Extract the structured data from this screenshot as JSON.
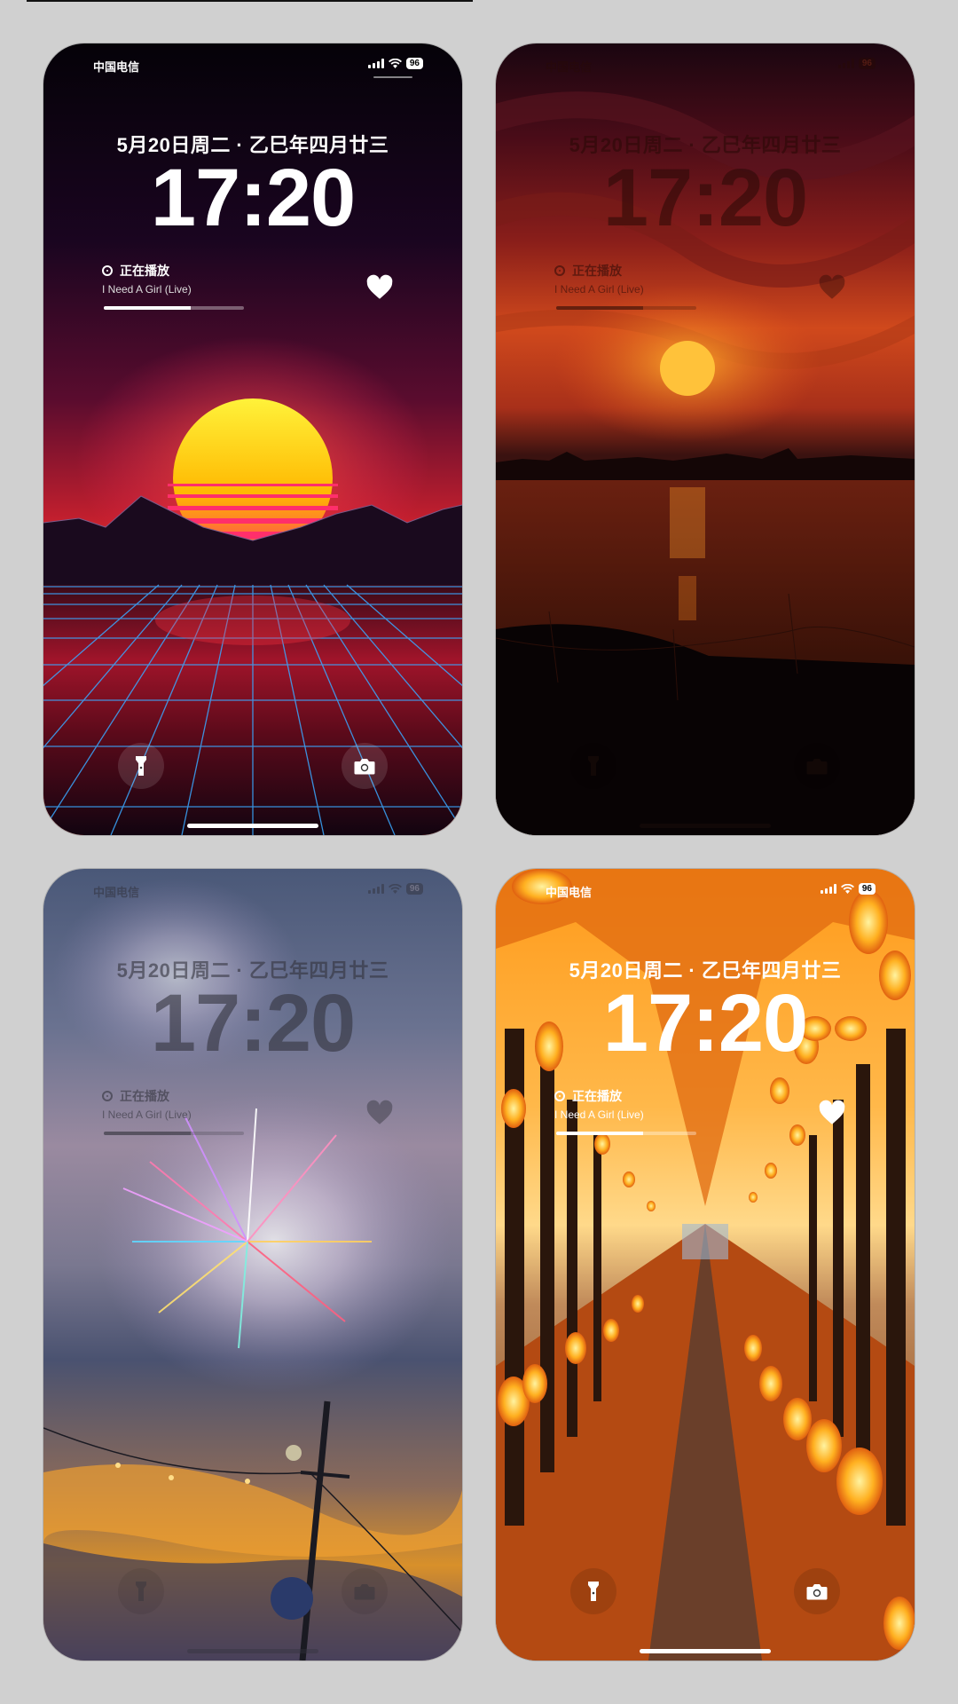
{
  "screens": [
    {
      "carrier": "中国电信",
      "battery": "96",
      "date": "5月20日周二 · 乙巳年四月廿三",
      "time": "17:20",
      "now_playing": {
        "label": "正在播放",
        "song": "I Need A Girl (Live)",
        "progress": 0.62
      },
      "heart": "heart-icon",
      "left_button": "flashlight-icon",
      "right_button": "camera-icon"
    },
    {
      "carrier": "中国电信",
      "battery": "96",
      "date": "5月20日周二 · 乙巳年四月廿三",
      "time": "17:20",
      "now_playing": {
        "label": "正在播放",
        "song": "I Need A Girl (Live)",
        "progress": 0.62
      },
      "heart": "heart-icon",
      "left_button": "flashlight-icon",
      "right_button": "camera-icon"
    },
    {
      "carrier": "中国电信",
      "battery": "96",
      "date": "5月20日周二 · 乙巳年四月廿三",
      "time": "17:20",
      "now_playing": {
        "label": "正在播放",
        "song": "I Need A Girl (Live)",
        "progress": 0.62
      },
      "heart": "heart-icon",
      "left_button": "flashlight-icon",
      "right_button": "camera-icon"
    },
    {
      "carrier": "中国电信",
      "battery": "96",
      "date": "5月20日周二 · 乙巳年四月廿三",
      "time": "17:20",
      "now_playing": {
        "label": "正在播放",
        "song": "I Need A Girl (Live)",
        "progress": 0.62
      },
      "heart": "heart-icon",
      "left_button": "flashlight-icon",
      "right_button": "camera-icon"
    }
  ],
  "wallpapers": [
    "synthwave-sunset",
    "river-sunset",
    "fireworks-dusk",
    "autumn-lantern-path"
  ],
  "colors": {
    "background": "#d0d0d0",
    "ui_text": "#ffffff"
  }
}
